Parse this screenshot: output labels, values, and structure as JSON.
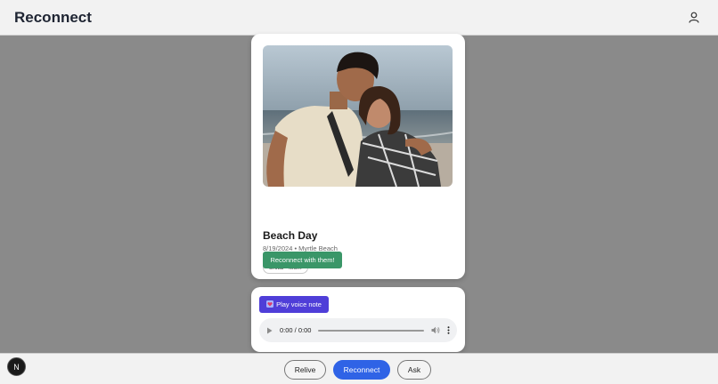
{
  "header": {
    "title": "Reconnect",
    "user_icon": "user-icon"
  },
  "memory": {
    "title": "Beach Day",
    "meta": "8/19/2024 • Myrtle Beach",
    "tag": "Shital • Mom",
    "reconnect_label": "Reconnect with them!"
  },
  "voice": {
    "play_label": "Play voice note",
    "icon": "heart-icon",
    "audio_time": "0:00 / 0:00"
  },
  "nav": {
    "relive": "Relive",
    "reconnect": "Reconnect",
    "ask": "Ask"
  },
  "dev_badge": "N",
  "colors": {
    "overlay": "#8a8a8a",
    "reconnect_green": "#3a9668",
    "voice_purple": "#4f3ed8",
    "nav_blue": "#2f63e6"
  }
}
